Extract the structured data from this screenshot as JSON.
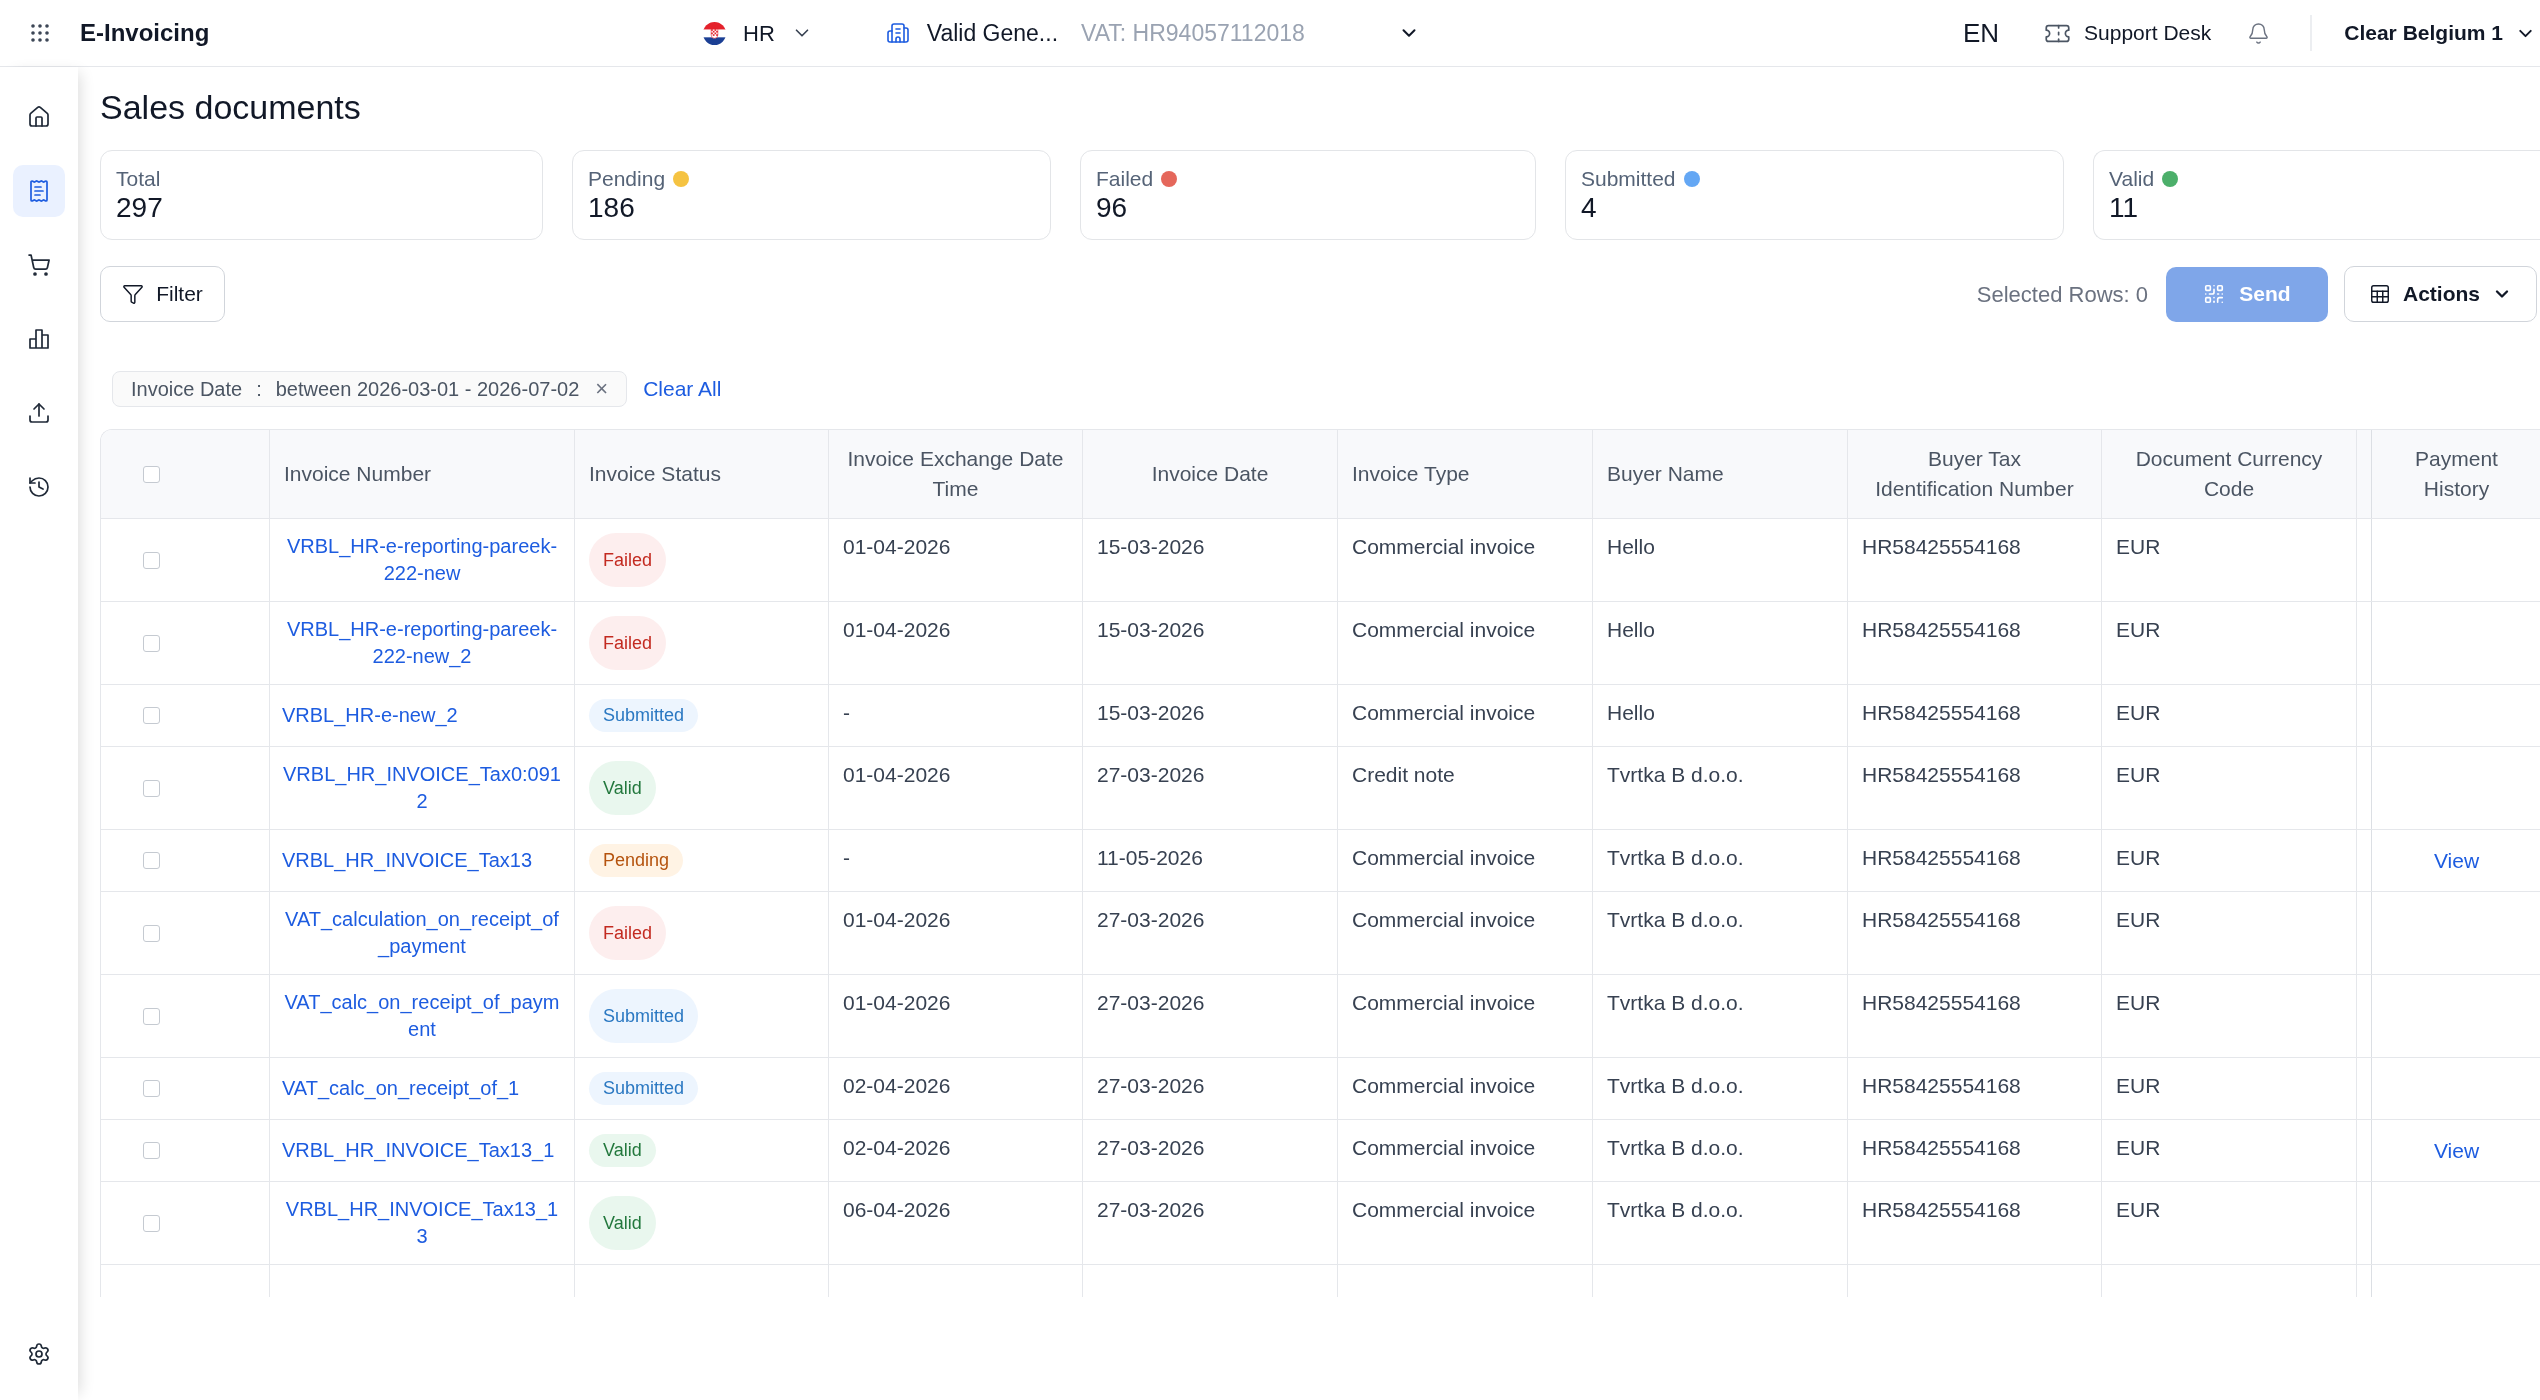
{
  "top_bar": {
    "app_title": "E-Invoicing",
    "country": "HR",
    "company": "Valid Gene...",
    "vat": "VAT: HR94057112018",
    "language": "EN",
    "support": "Support Desk",
    "account": "Clear Belgium 1"
  },
  "sidebar": {
    "items": [
      {
        "selected": false
      },
      {
        "selected": true
      },
      {
        "selected": false
      },
      {
        "selected": false
      },
      {
        "selected": false
      },
      {
        "selected": false
      }
    ],
    "footer_items": [
      {
        "selected": false
      }
    ]
  },
  "page_title": "Sales documents",
  "summary_cards": [
    {
      "label": "Total",
      "value": "297"
    },
    {
      "label": "Pending",
      "value": "186",
      "color": "#f5c342"
    },
    {
      "label": "Failed",
      "value": "96",
      "color": "#e5675b"
    },
    {
      "label": "Submitted",
      "value": "4",
      "color": "#64a7f4"
    },
    {
      "label": "Valid",
      "value": "11",
      "color": "#4caf6a"
    }
  ],
  "toolbar": {
    "filter_button": "Filter",
    "selected_rows": "Selected Rows: 0",
    "send_button": {
      "label": "Send",
      "disabled": true
    },
    "actions_button": "Actions"
  },
  "active_filters": [
    {
      "field": "Invoice Date",
      "separator": ":",
      "value": "between 2026-03-01 - 2026-07-02",
      "remove": "×"
    }
  ],
  "clear_all": "Clear All",
  "table": {
    "select_all": {
      "checked": false
    },
    "columns": [
      "Invoice Number",
      "Invoice Status",
      "Invoice Exchange Date Time",
      "Invoice Date",
      "Invoice Type",
      "Buyer Name",
      "Buyer Tax Identification Number",
      "Document Currency Code",
      "Payment History"
    ],
    "rows": [
      {
        "checked": false,
        "invoice_number": "VRBL_HR-e-reporting-pareek-222-new",
        "status": {
          "label": "Failed",
          "kind": "failed"
        },
        "exchange_date": "01-04-2026",
        "invoice_date": "15-03-2026",
        "invoice_type": "Commercial invoice",
        "buyer_name": "Hello",
        "buyer_tax_id": "HR58425554168",
        "currency": "EUR"
      },
      {
        "checked": false,
        "invoice_number": "VRBL_HR-e-reporting-pareek-222-new_2",
        "status": {
          "label": "Failed",
          "kind": "failed"
        },
        "exchange_date": "01-04-2026",
        "invoice_date": "15-03-2026",
        "invoice_type": "Commercial invoice",
        "buyer_name": "Hello",
        "buyer_tax_id": "HR58425554168",
        "currency": "EUR"
      },
      {
        "checked": false,
        "invoice_number": "VRBL_HR-e-new_2",
        "status": {
          "label": "Submitted",
          "kind": "submitted"
        },
        "exchange_date": "-",
        "invoice_date": "15-03-2026",
        "invoice_type": "Commercial invoice",
        "buyer_name": "Hello",
        "buyer_tax_id": "HR58425554168",
        "currency": "EUR"
      },
      {
        "checked": false,
        "invoice_number": "VRBL_HR_INVOICE_Tax0:0912",
        "status": {
          "label": "Valid",
          "kind": "valid"
        },
        "exchange_date": "01-04-2026",
        "invoice_date": "27-03-2026",
        "invoice_type": "Credit note",
        "buyer_name": "Tvrtka B d.o.o.",
        "buyer_tax_id": "HR58425554168",
        "currency": "EUR"
      },
      {
        "checked": false,
        "invoice_number": "VRBL_HR_INVOICE_Tax13",
        "status": {
          "label": "Pending",
          "kind": "pending"
        },
        "exchange_date": "-",
        "invoice_date": "11-05-2026",
        "invoice_type": "Commercial invoice",
        "buyer_name": "Tvrtka B d.o.o.",
        "buyer_tax_id": "HR58425554168",
        "currency": "EUR",
        "payment_history": "View"
      },
      {
        "checked": false,
        "invoice_number": "VAT_calculation_on_receipt_of_payment",
        "status": {
          "label": "Failed",
          "kind": "failed"
        },
        "exchange_date": "01-04-2026",
        "invoice_date": "27-03-2026",
        "invoice_type": "Commercial invoice",
        "buyer_name": "Tvrtka B d.o.o.",
        "buyer_tax_id": "HR58425554168",
        "currency": "EUR"
      },
      {
        "checked": false,
        "invoice_number": "VAT_calc_on_receipt_of_payment",
        "status": {
          "label": "Submitted",
          "kind": "submitted"
        },
        "exchange_date": "01-04-2026",
        "invoice_date": "27-03-2026",
        "invoice_type": "Commercial invoice",
        "buyer_name": "Tvrtka B d.o.o.",
        "buyer_tax_id": "HR58425554168",
        "currency": "EUR"
      },
      {
        "checked": false,
        "invoice_number": "VAT_calc_on_receipt_of_1",
        "status": {
          "label": "Submitted",
          "kind": "submitted"
        },
        "exchange_date": "02-04-2026",
        "invoice_date": "27-03-2026",
        "invoice_type": "Commercial invoice",
        "buyer_name": "Tvrtka B d.o.o.",
        "buyer_tax_id": "HR58425554168",
        "currency": "EUR"
      },
      {
        "checked": false,
        "invoice_number": "VRBL_HR_INVOICE_Tax13_1",
        "status": {
          "label": "Valid",
          "kind": "valid"
        },
        "exchange_date": "02-04-2026",
        "invoice_date": "27-03-2026",
        "invoice_type": "Commercial invoice",
        "buyer_name": "Tvrtka B d.o.o.",
        "buyer_tax_id": "HR58425554168",
        "currency": "EUR",
        "payment_history": "View"
      },
      {
        "checked": false,
        "invoice_number": "VRBL_HR_INVOICE_Tax13_13",
        "status": {
          "label": "Valid",
          "kind": "valid"
        },
        "exchange_date": "06-04-2026",
        "invoice_date": "27-03-2026",
        "invoice_type": "Commercial invoice",
        "buyer_name": "Tvrtka B d.o.o.",
        "buyer_tax_id": "HR58425554168",
        "currency": "EUR"
      }
    ]
  }
}
